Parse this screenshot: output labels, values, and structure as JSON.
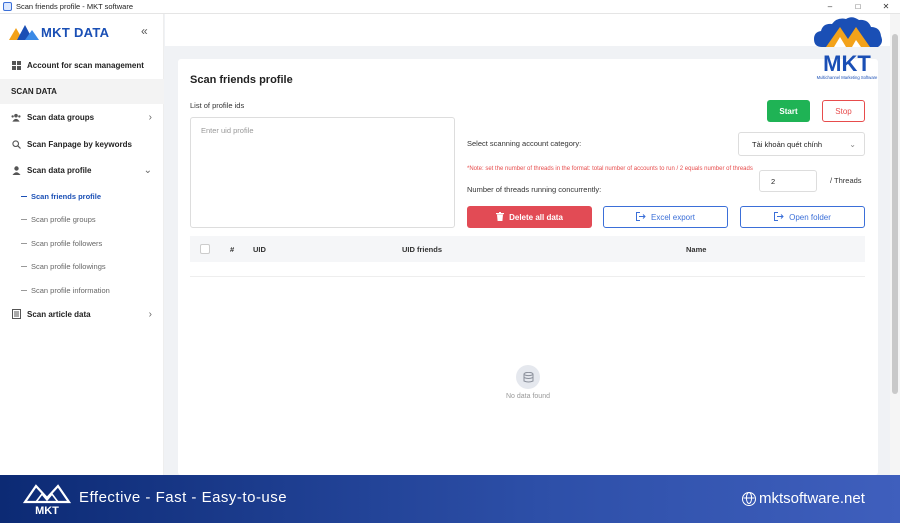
{
  "window": {
    "title": "Scan friends profile - MKT software",
    "controls": [
      "–",
      "□",
      "✕"
    ]
  },
  "sidebar": {
    "logo_text": "MKT DATA",
    "collapse_glyph": "«",
    "account_item": "Account for scan management",
    "section": "SCAN DATA",
    "items": [
      {
        "label": "Scan data groups",
        "icon": "users-icon"
      },
      {
        "label": "Scan Fanpage by keywords",
        "icon": "search-icon"
      },
      {
        "label": "Scan data profile",
        "icon": "user-icon"
      }
    ],
    "sub_items": [
      {
        "label": "Scan friends profile"
      },
      {
        "label": "Scan profile groups"
      },
      {
        "label": "Scan profile followers"
      },
      {
        "label": "Scan profile followings"
      },
      {
        "label": "Scan profile information"
      }
    ],
    "article_item": "Scan article data"
  },
  "main": {
    "title": "Scan friends profile",
    "list_label": "List of profile ids",
    "textarea_placeholder": "Enter uid profile",
    "start_label": "Start",
    "stop_label": "Stop",
    "category_label": "Select scanning account category:",
    "category_value": "Tài khoản quét chính",
    "note": "*Note: set the number of threads in the format: total number of accounts to run / 2 equals number of threads",
    "threads_label": "Number of threads running concurrently:",
    "threads_value": "2",
    "threads_unit": "/ Threads",
    "delete_label": "Delete all data",
    "excel_label": "Excel export",
    "folder_label": "Open folder",
    "table": {
      "headers": [
        "#",
        "UID",
        "UID friends",
        "Name"
      ]
    },
    "empty_text": "No data found"
  },
  "brand": {
    "name": "MKT",
    "subtitle": "Multichannel Marketing Software"
  },
  "footer": {
    "tagline": "Effective - Fast - Easy-to-use",
    "website": "mktsoftware.net"
  },
  "colors": {
    "accent": "#1a4fb5",
    "start": "#1fb355",
    "danger": "#e24b55"
  }
}
